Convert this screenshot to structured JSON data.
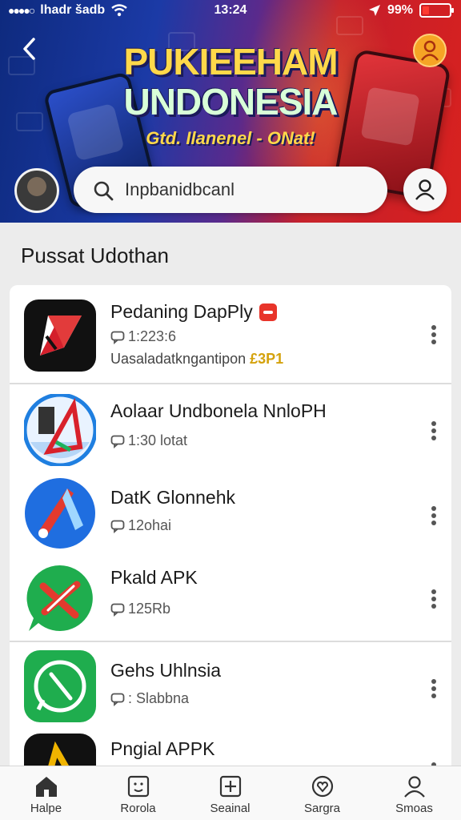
{
  "status_bar": {
    "carrier": "lhadr šadb",
    "time": "13:24",
    "battery": "99%"
  },
  "header": {
    "title_line1": "PUKIEEHAM",
    "title_line2": "UNDONESIA",
    "subtitle": "Gtd. Ilanenel - ONat!",
    "colors": {
      "left": "#1b3aa6",
      "right": "#d8221f",
      "title": "#ffd84a"
    }
  },
  "search": {
    "placeholder": "Inpbanidbcanl"
  },
  "section": {
    "title": "Pussat Udothan"
  },
  "apps": [
    {
      "name": "Pedaning DapPly",
      "meta": "1:223:6",
      "description": "Uasaladatkngantipon",
      "promo": "£3P1",
      "has_badge": true
    },
    {
      "name": "Aolaar Undbonela NnloPH",
      "meta": "1:30 lotat"
    },
    {
      "name": "DatK Glonnehk",
      "meta": "12ohai"
    },
    {
      "name": "Pkald APK",
      "meta": "125Rb"
    },
    {
      "name": "Gehs Uhlnsia",
      "meta": ": Slabbna"
    },
    {
      "name": "Pngial APPK"
    }
  ],
  "bottom_nav": [
    {
      "label": "Halpe",
      "icon": "home-icon",
      "active": true
    },
    {
      "label": "Rorola",
      "icon": "smile-card-icon"
    },
    {
      "label": "Seainal",
      "icon": "add-square-icon"
    },
    {
      "label": "Sargra",
      "icon": "heart-icon"
    },
    {
      "label": "Smoas",
      "icon": "person-icon"
    }
  ]
}
